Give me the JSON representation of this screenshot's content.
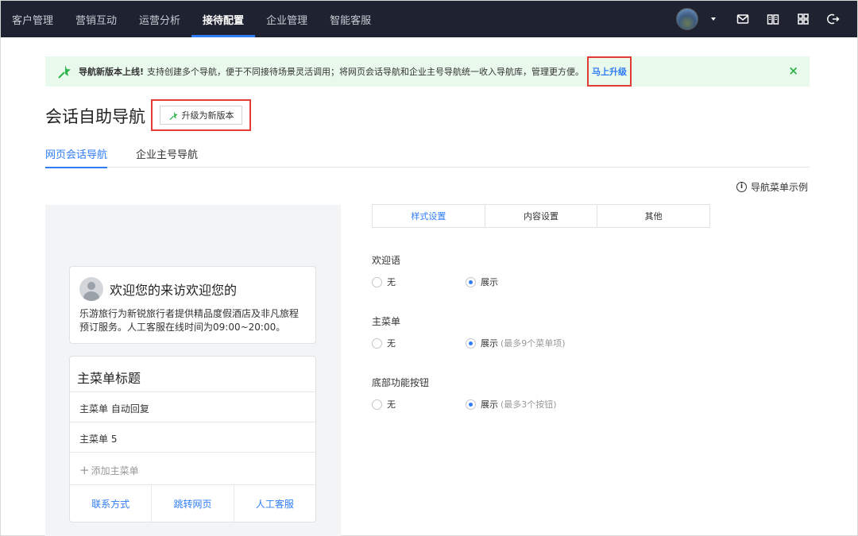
{
  "topnav": {
    "items": [
      {
        "label": "客户管理",
        "active": false
      },
      {
        "label": "营销互动",
        "active": false
      },
      {
        "label": "运营分析",
        "active": false
      },
      {
        "label": "接待配置",
        "active": true
      },
      {
        "label": "企业管理",
        "active": false
      },
      {
        "label": "智能客服",
        "active": false
      }
    ],
    "icons": [
      "avatar",
      "chevron-down-icon",
      "mail-icon",
      "book-icon",
      "grid-icon",
      "logout-icon"
    ]
  },
  "banner": {
    "title": "导航新版本上线!",
    "text": "支持创建多个导航，便于不同接待场景灵活调用；将网页会话导航和企业主号导航统一收入导航库，管理更方便。",
    "link": "马上升级",
    "close": "×"
  },
  "page": {
    "title": "会话自助导航",
    "upgrade_button": "升级为新版本"
  },
  "tabs": [
    {
      "label": "网页会话导航",
      "active": true
    },
    {
      "label": "企业主号导航",
      "active": false
    }
  ],
  "example_link": "导航菜单示例",
  "preview": {
    "welcome_title": "欢迎您的来访欢迎您的",
    "welcome_line1": "乐游旅行为新锐旅行者提供精品度假酒店及非凡旅程",
    "welcome_line2": "预订服务。人工客服在线时间为09:00~20:00。",
    "menu_title": "主菜单标题",
    "menu_items": [
      "主菜单 自动回复",
      "主菜单 5"
    ],
    "add_menu": "添加主菜单",
    "footer_buttons": [
      "联系方式",
      "跳转网页",
      "人工客服"
    ]
  },
  "settings": {
    "segments": [
      {
        "label": "样式设置",
        "active": true
      },
      {
        "label": "内容设置",
        "active": false
      },
      {
        "label": "其他",
        "active": false
      }
    ],
    "sections": [
      {
        "label": "欢迎语",
        "option_off": "无",
        "option_on": "展示",
        "hint": ""
      },
      {
        "label": "主菜单",
        "option_off": "无",
        "option_on": "展示",
        "hint": "(最多9个菜单项)"
      },
      {
        "label": "底部功能按钮",
        "option_off": "无",
        "option_on": "展示",
        "hint": "(最多3个按钮)"
      }
    ]
  },
  "colors": {
    "accent": "#2f7cf6",
    "topbar": "#1f2230",
    "banner_bg": "#e9f9ec",
    "highlight": "#e23b33",
    "success": "#2cb34a"
  }
}
